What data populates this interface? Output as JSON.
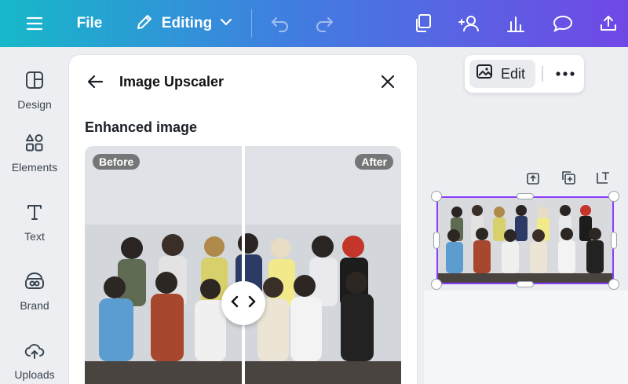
{
  "topbar": {
    "file_label": "File",
    "editing_label": "Editing"
  },
  "rail": {
    "items": [
      {
        "label": "Design",
        "icon": "design-icon"
      },
      {
        "label": "Elements",
        "icon": "elements-icon"
      },
      {
        "label": "Text",
        "icon": "text-icon"
      },
      {
        "label": "Brand",
        "icon": "brand-icon"
      },
      {
        "label": "Uploads",
        "icon": "uploads-icon"
      }
    ]
  },
  "panel": {
    "title": "Image Upscaler",
    "section_title": "Enhanced image",
    "before_label": "Before",
    "after_label": "After"
  },
  "canvas_toolbar": {
    "edit_label": "Edit"
  },
  "colors": {
    "gradient_start": "#17b8c9",
    "gradient_end": "#7148e6",
    "selection": "#8b3dff"
  }
}
